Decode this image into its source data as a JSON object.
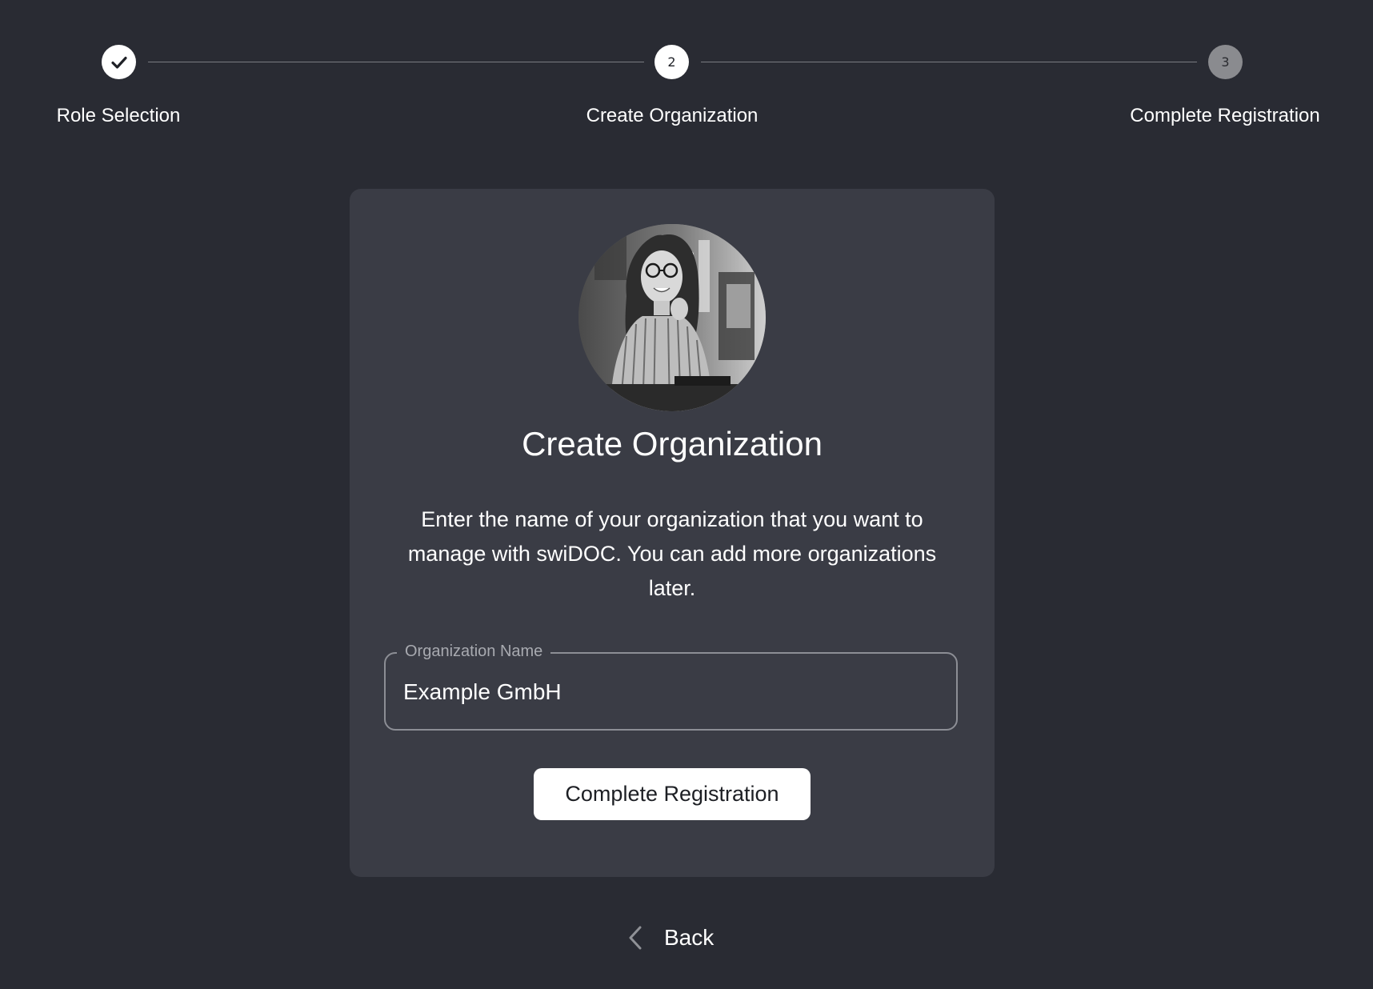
{
  "stepper": {
    "steps": [
      {
        "number": "",
        "label": "Role Selection",
        "state": "done",
        "icon": "check-icon"
      },
      {
        "number": "2",
        "label": "Create Organization",
        "state": "active"
      },
      {
        "number": "3",
        "label": "Complete Registration",
        "state": "pending"
      }
    ]
  },
  "card": {
    "avatar_alt": "avatar-photo",
    "title": "Create Organization",
    "description": "Enter the name of your organization that you want to manage with swiDOC. You can add more organizations later.",
    "field": {
      "label": "Organization Name",
      "value": "Example GmbH"
    },
    "submit_label": "Complete Registration"
  },
  "footer": {
    "back_label": "Back",
    "back_icon": "chevron-left-icon"
  },
  "colors": {
    "background": "#292b33",
    "card": "#3a3c45",
    "text": "#ffffff",
    "muted": "#a8aab0",
    "pending_step": "#8a8b8f"
  }
}
